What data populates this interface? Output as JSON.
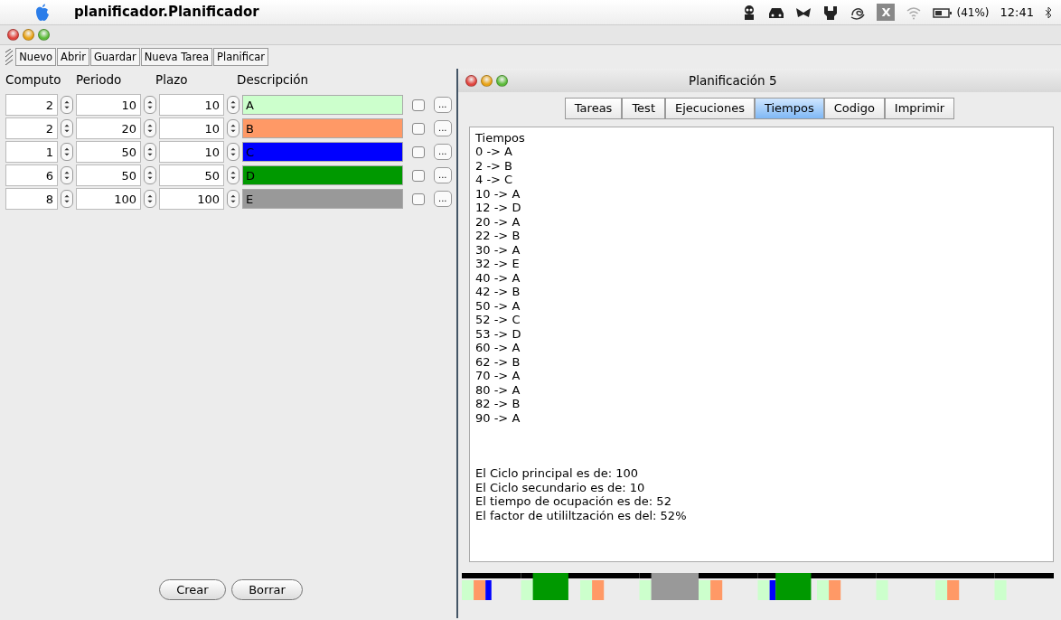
{
  "menu_bar": {
    "app_name": "planificador.Planificador",
    "status_icons": [
      {
        "kind": "robot"
      },
      {
        "kind": "car"
      },
      {
        "kind": "butterfly"
      },
      {
        "kind": "wrench"
      },
      {
        "kind": "swirl"
      },
      {
        "kind": "x",
        "label": "X"
      },
      {
        "kind": "wifi"
      },
      {
        "kind": "battery"
      }
    ],
    "battery": "(41%)",
    "clock": "12:41"
  },
  "toolbar": [
    "Nuevo",
    "Abrir",
    "Guardar",
    "Nueva Tarea",
    "Planificar"
  ],
  "table": {
    "columns": [
      "Computo",
      "Periodo",
      "Plazo",
      "Descripción"
    ],
    "rows": [
      {
        "computo": "2",
        "periodo": "10",
        "plazo": "10",
        "descripcion": "A",
        "color": "#ccffcc",
        "checked": false,
        "button": "..."
      },
      {
        "computo": "2",
        "periodo": "20",
        "plazo": "10",
        "descripcion": "B",
        "color": "#ff9966",
        "checked": false,
        "button": "..."
      },
      {
        "computo": "1",
        "periodo": "50",
        "plazo": "10",
        "descripcion": "C",
        "color": "#0000ff",
        "checked": false,
        "button": "..."
      },
      {
        "computo": "6",
        "periodo": "50",
        "plazo": "50",
        "descripcion": "D",
        "color": "#009900",
        "checked": false,
        "button": "..."
      },
      {
        "computo": "8",
        "periodo": "100",
        "plazo": "100",
        "descripcion": "E",
        "color": "#999999",
        "checked": false,
        "button": "..."
      }
    ]
  },
  "buttons": [
    "Crear",
    "Borrar"
  ],
  "child_window": {
    "title": "Planificación 5",
    "tabs": [
      {
        "label": "Tareas",
        "selected": false
      },
      {
        "label": "Test",
        "selected": false
      },
      {
        "label": "Ejecuciones",
        "selected": false
      },
      {
        "label": "Tiempos",
        "selected": true
      },
      {
        "label": "Codigo",
        "selected": false
      },
      {
        "label": "Imprimir",
        "selected": false
      }
    ],
    "output_lines": [
      "Tiempos",
      "0 -> A",
      "2 -> B",
      "4 -> C",
      "10 -> A",
      "12 -> D",
      "20 -> A",
      "22 -> B",
      "30 -> A",
      "32 -> E",
      "40 -> A",
      "42 -> B",
      "50 -> A",
      "52 -> C",
      "53 -> D",
      "60 -> A",
      "62 -> B",
      "70 -> A",
      "80 -> A",
      "82 -> B",
      "90 -> A"
    ],
    "summary_lines": [
      "El Ciclo principal es de: 100",
      "El Ciclo secundario es de: 10",
      "El tiempo de ocupación es de: 52",
      "El factor de utililtzación es del: 52%"
    ]
  }
}
